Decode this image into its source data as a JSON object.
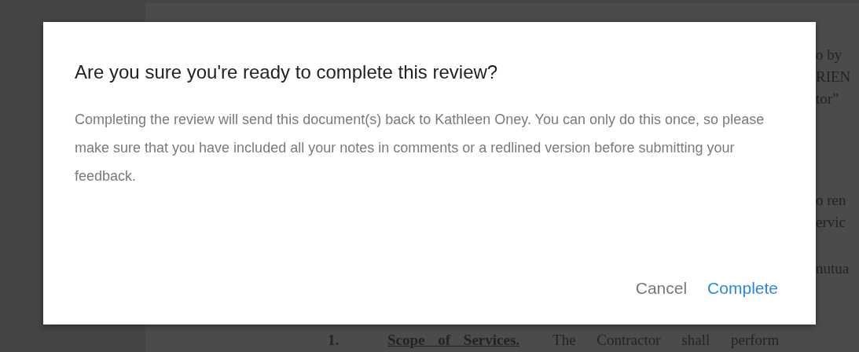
{
  "document": {
    "margin_fragments": [
      "o by",
      "RIEN",
      "tor”",
      "o ren",
      "ervic",
      "nutua"
    ],
    "section": {
      "number": "1.",
      "heading": "Scope of Services.",
      "text": "The Contractor shall perform"
    }
  },
  "dialog": {
    "title": "Are you sure you're ready to complete this review?",
    "message": "Completing the review will send this document(s) back to Kathleen Oney. You can only do this once, so please make sure that you have included all your notes in comments or a redlined version before submitting your feedback.",
    "buttons": [
      {
        "label": "Cancel",
        "kind": "secondary"
      },
      {
        "label": "Complete",
        "kind": "primary"
      }
    ]
  }
}
